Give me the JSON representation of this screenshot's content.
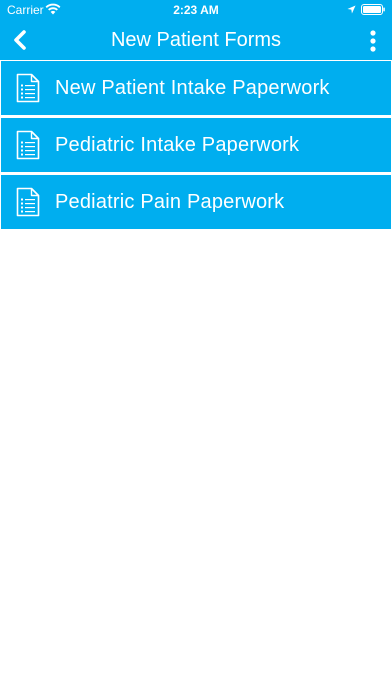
{
  "status_bar": {
    "carrier": "Carrier",
    "time": "2:23 AM",
    "icons": [
      "wifi-icon",
      "location-icon",
      "battery-icon"
    ]
  },
  "nav": {
    "title": "New Patient Forms",
    "back_icon": "chevron-left-icon",
    "more_icon": "more-vertical-icon"
  },
  "forms": [
    {
      "label": "New Patient Intake Paperwork",
      "icon": "document-icon"
    },
    {
      "label": "Pediatric Intake Paperwork",
      "icon": "document-icon"
    },
    {
      "label": "Pediatric Pain Paperwork",
      "icon": "document-icon"
    }
  ],
  "colors": {
    "accent": "#00aeef",
    "text_on_accent": "#ffffff",
    "background": "#ffffff"
  }
}
